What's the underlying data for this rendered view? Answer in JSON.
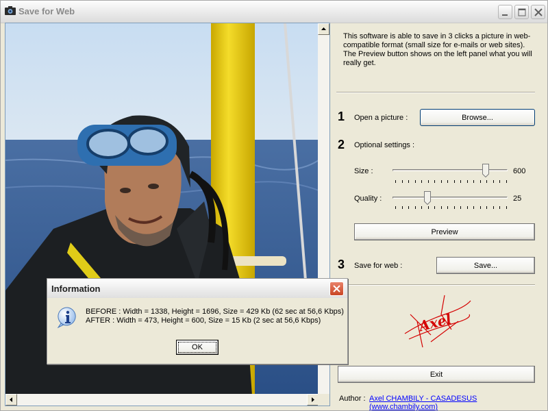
{
  "window": {
    "title": "Save for Web",
    "icon": "camera-icon",
    "controls": [
      "minimize-icon",
      "maximize-icon",
      "close-icon"
    ]
  },
  "right_panel": {
    "description": "This software is able to save in 3 clicks a picture in web-compatible format (small size for e-mails or web sites). The Preview button shows on the left panel what you will really get.",
    "step1": {
      "number": "1",
      "label": "Open a picture :",
      "button": "Browse..."
    },
    "step2": {
      "number": "2",
      "label": "Optional settings :",
      "size": {
        "label": "Size :",
        "value": "600",
        "position": 0.83
      },
      "quality": {
        "label": "Quality :",
        "value": "25",
        "position": 0.29
      },
      "preview_button": "Preview"
    },
    "step3": {
      "number": "3",
      "label": "Save for web :",
      "button": "Save..."
    },
    "logo_text": "Axel",
    "exit_button": "Exit",
    "author_label": "Author :",
    "author_link": "Axel CHAMBILY - CASADESUS (www.chambily.com)"
  },
  "dialog": {
    "title": "Information",
    "icon": "info-icon",
    "line1": "BEFORE : Width = 1338, Height = 1696, Size = 429 Kb (62 sec at 56,6 Kbps)",
    "line2": "AFTER : Width = 473, Height = 600, Size = 15 Kb (2 sec at 56,6 Kbps)",
    "ok_button": "OK"
  },
  "colors": {
    "window_bg": "#ece9d8",
    "dialog_close": "#c94524",
    "link": "#0000ff",
    "logo": "#d40000"
  }
}
